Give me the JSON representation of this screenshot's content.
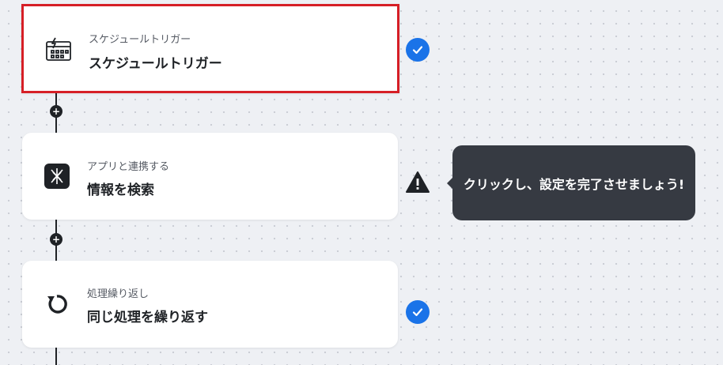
{
  "steps": [
    {
      "subtitle": "スケジュールトリガー",
      "title": "スケジュールトリガー",
      "status": "complete",
      "icon": "calendar-bolt-icon"
    },
    {
      "subtitle": "アプリと連携する",
      "title": "情報を検索",
      "status": "warning",
      "icon": "app-logo-icon"
    },
    {
      "subtitle": "処理繰り返し",
      "title": "同じ処理を繰り返す",
      "status": "complete",
      "icon": "repeat-icon"
    }
  ],
  "tooltip": {
    "text": "クリックし、設定を完了させましょう!"
  },
  "colors": {
    "accent": "#1a73e8",
    "selected_border": "#d61f26",
    "tooltip_bg": "#363a42"
  }
}
